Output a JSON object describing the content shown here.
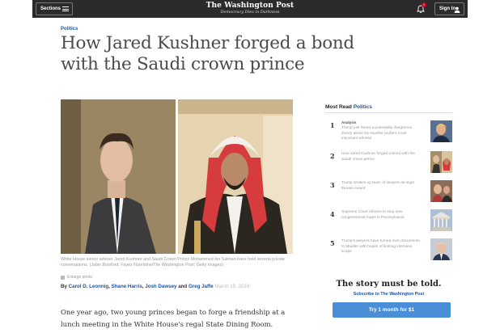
{
  "topbar": {
    "sections_label": "Sections",
    "logo": "The Washington Post",
    "tagline": "Democracy Dies in Darkness",
    "notification_count": "1",
    "signin_label": "Sign In"
  },
  "article": {
    "kicker": "Politics",
    "headline": "How Jared Kushner forged a bond with the Saudi crown prince",
    "caption": "White House senior adviser Jared Kushner and Saudi Crown Prince Mohammed bin Salman have held several private conversations. (Jabin Botsford; Fayez Nureldine/The Washington Post; Getty Images)",
    "credit_label": "Enlarge photo",
    "byline_prefix": "By",
    "authors": [
      "Carol D. Leonnig",
      "Shane Harris",
      "Josh Dawsey"
    ],
    "byline_and": "and",
    "last_author": "Greg Jaffe",
    "date": "March 19, 2018",
    "body": "One year ago, two young princes began to forge a friendship at a lunch meeting in the White House's regal State Dining Room."
  },
  "sidebar": {
    "most_read_label": "Most Read",
    "most_read_section": "Politics",
    "items": [
      {
        "num": "1",
        "label": "Analysis",
        "text": "Trump just heard a potentially dangerous theory about the Mueller probe's most important witness",
        "thumb": "trump"
      },
      {
        "num": "2",
        "label": "",
        "text": "How Jared Kushner forged a bond with the Saudi crown prince",
        "thumb": "kushner"
      },
      {
        "num": "3",
        "label": "",
        "text": "Trump shakes up team of lawyers as legal threats mount",
        "thumb": "people"
      },
      {
        "num": "4",
        "label": "",
        "text": "Supreme Court refuses to stop new congressional maps in Pennsylvania",
        "thumb": "court"
      },
      {
        "num": "5",
        "label": "",
        "text": "Trump's lawyers have turned over documents to Mueller with hopes of limiting interview scope",
        "thumb": "mueller"
      }
    ],
    "cta_title": "The story must be told.",
    "cta_sub": "Subscribe to The Washington Post",
    "cta_button": "Try 1 month for $1"
  },
  "colors": {
    "accent_blue": "#1955a5",
    "topbar_bg": "#2b2b2b",
    "cta_button": "#4b8ed8",
    "badge_red": "#d0021b"
  }
}
